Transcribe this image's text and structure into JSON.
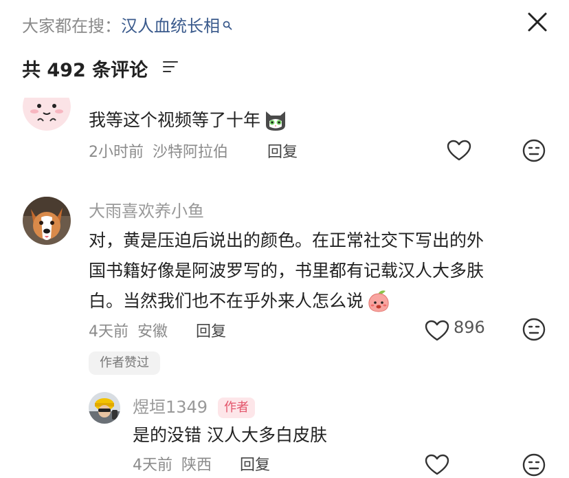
{
  "header": {
    "search_prefix": "大家都在搜：",
    "search_keyword": "汉人血统长相",
    "comment_count_title": "共 492 条评论"
  },
  "comments": [
    {
      "text": "我等这个视频等了十年",
      "time": "2小时前",
      "location": "沙特阿拉伯",
      "reply_label": "回复"
    },
    {
      "username": "大雨喜欢养小鱼",
      "text_lines": [
        "对，黄是压迫后说出的颜色。在正常社交下写出的外",
        "国书籍好像是阿波罗写的，书里都有记载汉人大多肤",
        "白。当然我们也不在乎外来人怎么说"
      ],
      "time": "4天前",
      "location": "安徽",
      "reply_label": "回复",
      "likes": "896",
      "author_liked_badge": "作者赞过",
      "replies": [
        {
          "username": "煜垣1349",
          "author_tag": "作者",
          "text": "是的没错 汉人大多白皮肤",
          "time": "4天前",
          "location": "陕西",
          "reply_label": "回复"
        }
      ]
    }
  ],
  "colors": {
    "keyword": "#3a5a8c",
    "meta_gray": "#8a8a8a",
    "author_tag_bg": "#fde6e9",
    "author_tag_text": "#e3546a"
  },
  "icons": [
    "search-icon",
    "close-icon",
    "sort-icon",
    "heart-icon",
    "emoji-icon",
    "cat-emoji-icon",
    "peach-emoji-icon",
    "avatar"
  ]
}
